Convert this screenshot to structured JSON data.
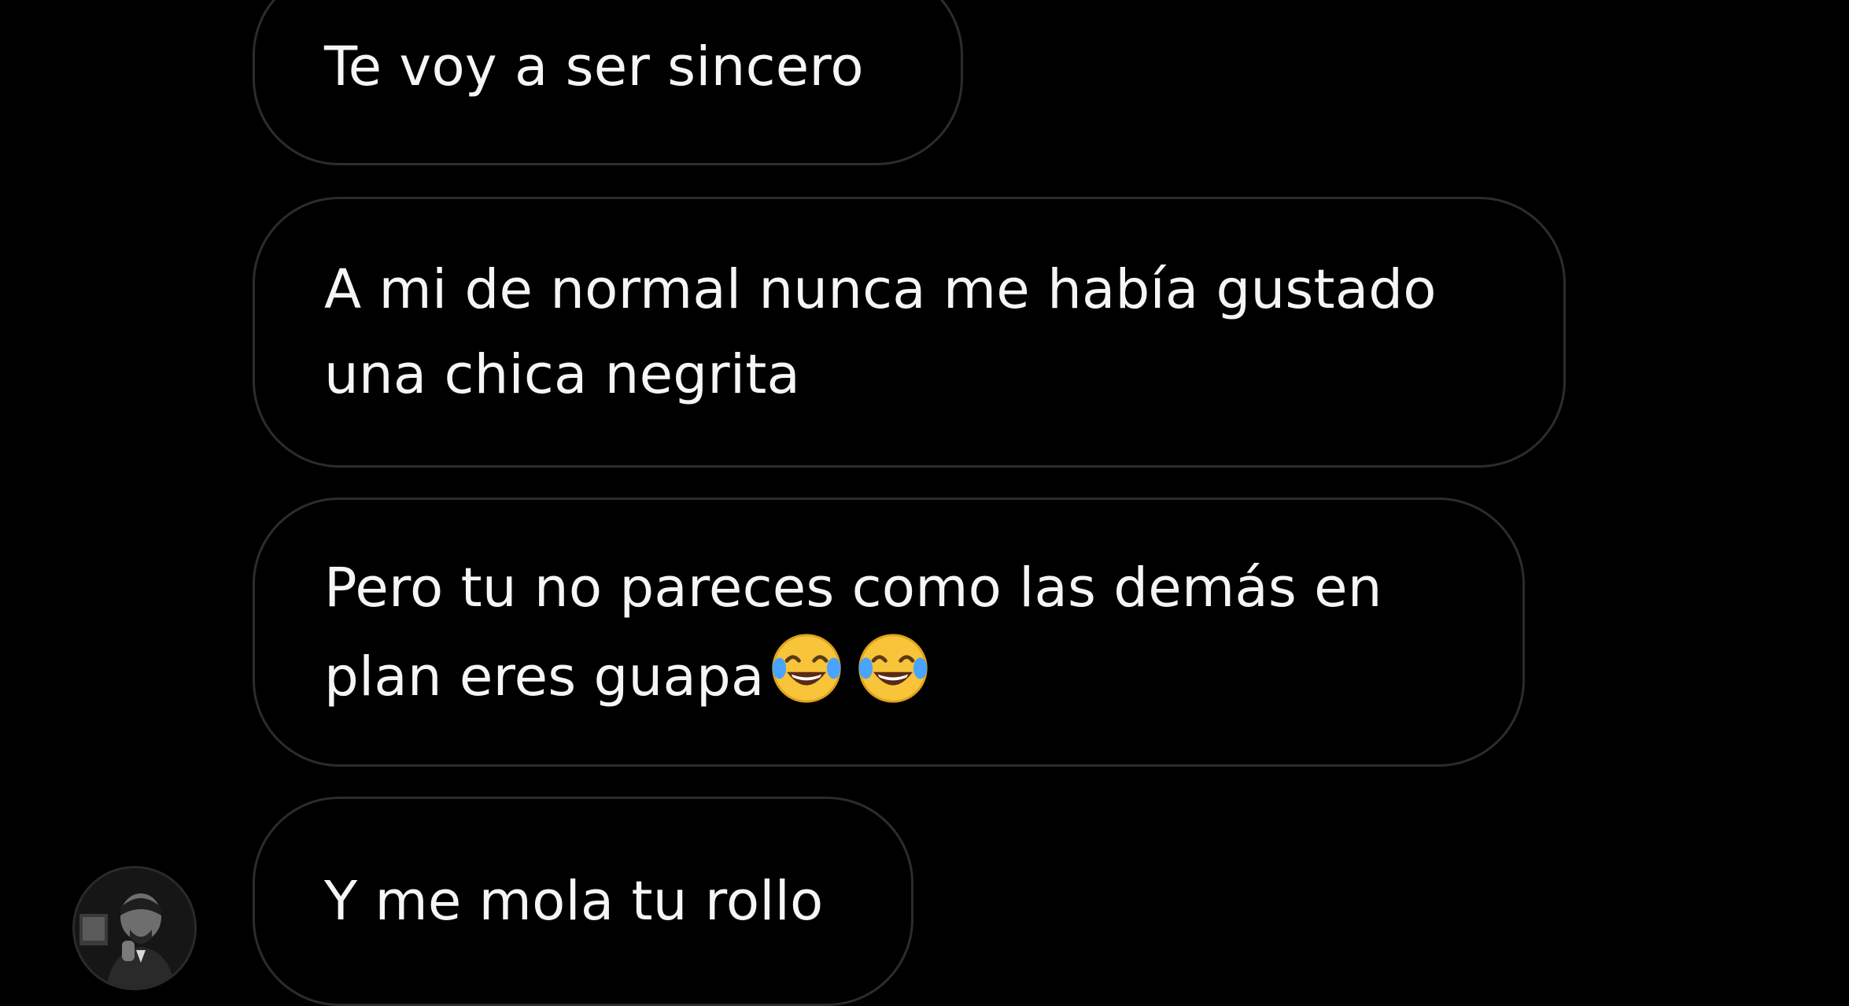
{
  "conversation": {
    "messages": [
      {
        "text": "Te voy a ser sincero"
      },
      {
        "text": "A mi de normal nunca me había gustado\nuna chica negrita"
      },
      {
        "text": "Pero tu no pareces como las demás en\nplan eres guapa",
        "emojis": [
          "face-with-tears-of-joy-icon",
          "face-with-tears-of-joy-icon"
        ]
      },
      {
        "text": "Y me mola tu rollo"
      }
    ],
    "sender_avatar": "profile-photo"
  },
  "colors": {
    "background": "#000000",
    "bubble_border": "#2c2c2c",
    "text": "#f5f5f5",
    "emoji_face": "#f7c43a",
    "emoji_tears": "#4aa3ff"
  }
}
